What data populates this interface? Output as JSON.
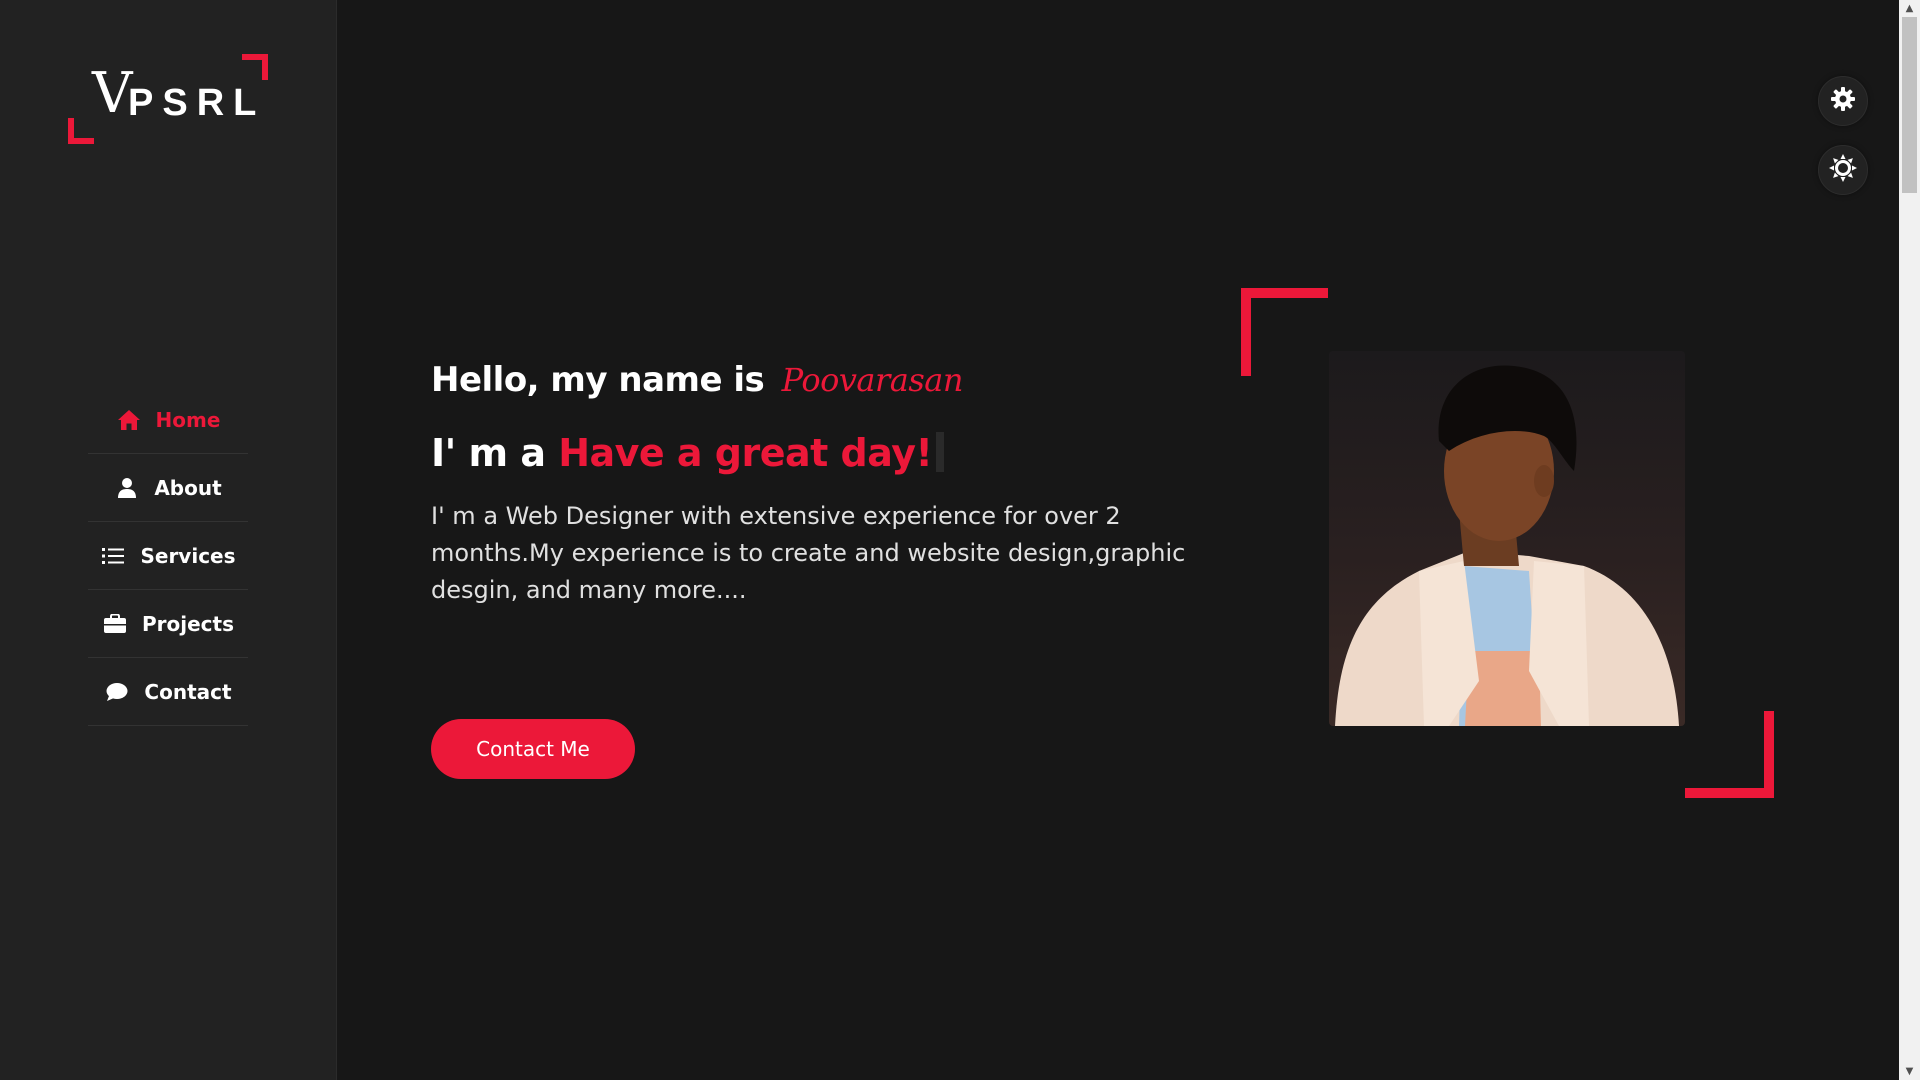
{
  "logo": {
    "mark": "V",
    "text": "PSRL"
  },
  "nav": {
    "items": [
      {
        "label": "Home",
        "icon": "home-icon",
        "active": true
      },
      {
        "label": "About",
        "icon": "user-icon",
        "active": false
      },
      {
        "label": "Services",
        "icon": "list-icon",
        "active": false
      },
      {
        "label": "Projects",
        "icon": "briefcase-icon",
        "active": false
      },
      {
        "label": "Contact",
        "icon": "comment-icon",
        "active": false
      }
    ]
  },
  "intro": {
    "hello_prefix": "Hello, my name is",
    "name": "Poovarasan",
    "iam_prefix": "I' m a",
    "typed": "Have a great day!",
    "description": "I' m a Web Designer with extensive experience for over 2 months.My experience is to create and website design,graphic desgin, and many more...."
  },
  "buttons": {
    "contact": "Contact Me"
  },
  "floating": {
    "settings_icon": "gear-icon",
    "theme_icon": "sun-icon"
  },
  "colors": {
    "accent": "#ec1839",
    "background": "#171717",
    "sidebar": "#222222"
  }
}
